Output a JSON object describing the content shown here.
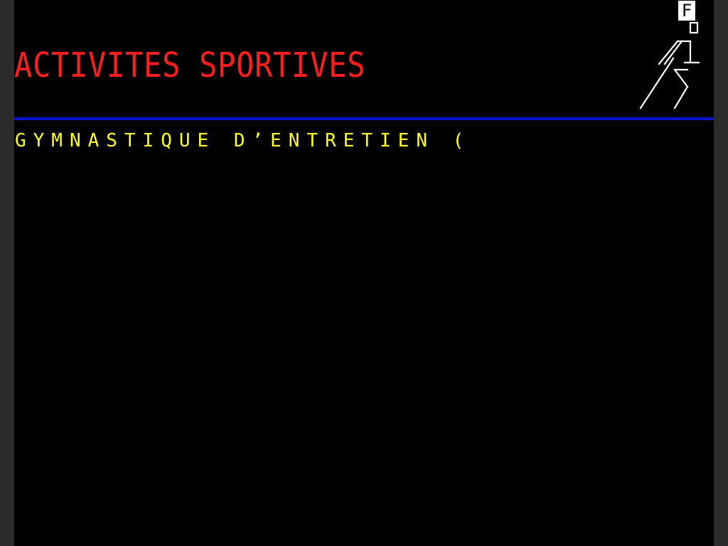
{
  "page": {
    "title": "ACTIVITES SPORTIVES",
    "subtitle": "GYMNASTIQUE D’ENTRETIEN (",
    "badge": "F",
    "logo_icon": "running-figure-icon"
  },
  "colors": {
    "background": "#000000",
    "title": "#ff1e1e",
    "subtitle": "#ffff26",
    "divider": "#0a14c8",
    "logo": "#ffffff"
  }
}
